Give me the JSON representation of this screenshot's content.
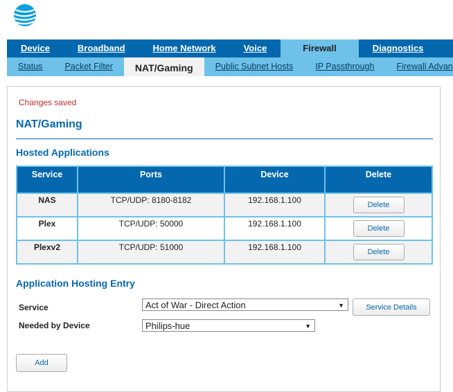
{
  "brand": {
    "logo": "AT&T globe"
  },
  "nav": {
    "tabs": [
      "Device",
      "Broadband",
      "Home Network",
      "Voice",
      "Firewall",
      "Diagnostics"
    ],
    "active": "Firewall"
  },
  "subnav": {
    "tabs": [
      "Status",
      "Packet Filter",
      "NAT/Gaming",
      "Public Subnet Hosts",
      "IP Passthrough",
      "Firewall Advanced"
    ],
    "active": "NAT/Gaming"
  },
  "status": "Changes saved",
  "page_title": "NAT/Gaming",
  "hosted": {
    "title": "Hosted Applications",
    "columns": [
      "Service",
      "Ports",
      "Device",
      "Delete"
    ],
    "rows": [
      {
        "service": "NAS",
        "ports": "TCP/UDP: 8180-8182",
        "device": "192.168.1.100",
        "action": "Delete"
      },
      {
        "service": "Plex",
        "ports": "TCP/UDP: 50000",
        "device": "192.168.1.100",
        "action": "Delete"
      },
      {
        "service": "Plexv2",
        "ports": "TCP/UDP: 51000",
        "device": "192.168.1.100",
        "action": "Delete"
      }
    ]
  },
  "entry": {
    "title": "Application Hosting Entry",
    "service_label": "Service",
    "service_value": "Act of War - Direct Action",
    "details_button": "Service Details",
    "device_label": "Needed by Device",
    "device_value": "Philips-hue",
    "add_button": "Add"
  },
  "colors": {
    "primary": "#0568ae",
    "light": "#6ec1e8",
    "error": "#c0282d"
  }
}
